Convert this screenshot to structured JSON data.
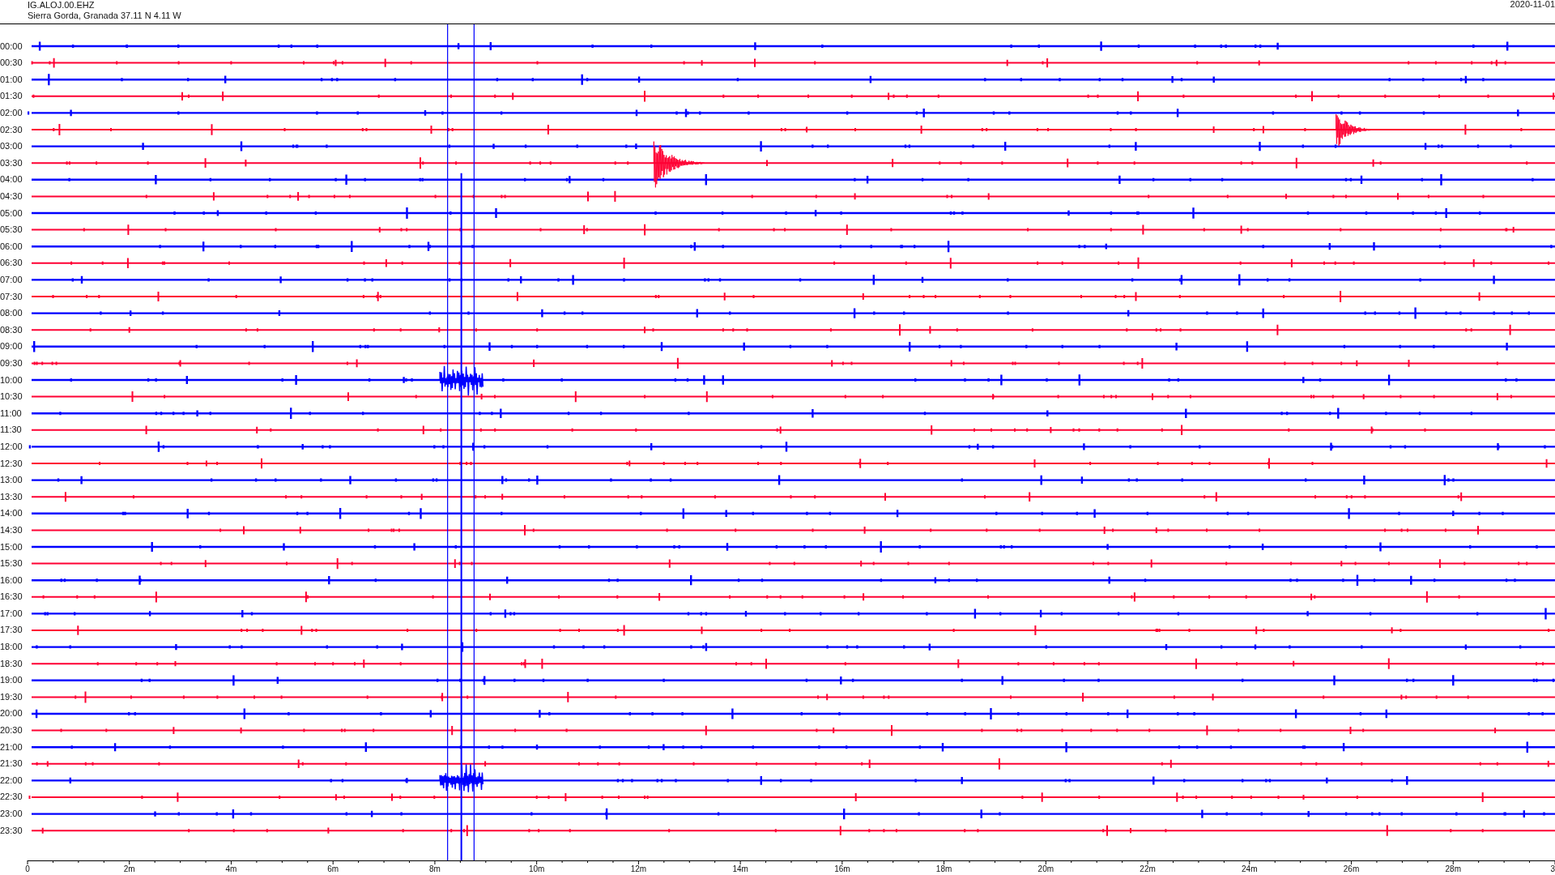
{
  "header": {
    "station": "IG.ALOJ.00.EHZ",
    "location": "Sierra Gorda, Granada  37.11 N 4.11 W",
    "date": "2020-11-01"
  },
  "rows": [
    {
      "time": "00:00",
      "color": "#0000ff"
    },
    {
      "time": "00:30",
      "color": "#ff0033"
    },
    {
      "time": "01:00",
      "color": "#0000ff"
    },
    {
      "time": "01:30",
      "color": "#ff0033"
    },
    {
      "time": "02:00",
      "color": "#0000ff"
    },
    {
      "time": "02:30",
      "color": "#ff0033"
    },
    {
      "time": "03:00",
      "color": "#0000ff"
    },
    {
      "time": "03:30",
      "color": "#ff0033"
    },
    {
      "time": "04:00",
      "color": "#0000ff"
    },
    {
      "time": "04:30",
      "color": "#ff0033"
    },
    {
      "time": "05:00",
      "color": "#0000ff"
    },
    {
      "time": "05:30",
      "color": "#ff0033"
    },
    {
      "time": "06:00",
      "color": "#0000ff"
    },
    {
      "time": "06:30",
      "color": "#ff0033"
    },
    {
      "time": "07:00",
      "color": "#0000ff"
    },
    {
      "time": "07:30",
      "color": "#ff0033"
    },
    {
      "time": "08:00",
      "color": "#0000ff"
    },
    {
      "time": "08:30",
      "color": "#ff0033"
    },
    {
      "time": "09:00",
      "color": "#0000ff"
    },
    {
      "time": "09:30",
      "color": "#ff0033"
    },
    {
      "time": "10:00",
      "color": "#0000ff"
    },
    {
      "time": "10:30",
      "color": "#ff0033"
    },
    {
      "time": "11:00",
      "color": "#0000ff"
    },
    {
      "time": "11:30",
      "color": "#ff0033"
    },
    {
      "time": "12:00",
      "color": "#0000ff"
    },
    {
      "time": "12:30",
      "color": "#ff0033"
    },
    {
      "time": "13:00",
      "color": "#0000ff"
    },
    {
      "time": "13:30",
      "color": "#ff0033"
    },
    {
      "time": "14:00",
      "color": "#0000ff"
    },
    {
      "time": "14:30",
      "color": "#ff0033"
    },
    {
      "time": "15:00",
      "color": "#0000ff"
    },
    {
      "time": "15:30",
      "color": "#ff0033"
    },
    {
      "time": "16:00",
      "color": "#0000ff"
    },
    {
      "time": "16:30",
      "color": "#ff0033"
    },
    {
      "time": "17:00",
      "color": "#0000ff"
    },
    {
      "time": "17:30",
      "color": "#ff0033"
    },
    {
      "time": "18:00",
      "color": "#0000ff"
    },
    {
      "time": "18:30",
      "color": "#ff0033"
    },
    {
      "time": "19:00",
      "color": "#0000ff"
    },
    {
      "time": "19:30",
      "color": "#ff0033"
    },
    {
      "time": "20:00",
      "color": "#0000ff"
    },
    {
      "time": "20:30",
      "color": "#ff0033"
    },
    {
      "time": "21:00",
      "color": "#0000ff"
    },
    {
      "time": "21:30",
      "color": "#ff0033"
    },
    {
      "time": "22:00",
      "color": "#0000ff"
    },
    {
      "time": "22:30",
      "color": "#ff0033"
    },
    {
      "time": "23:00",
      "color": "#0000ff"
    },
    {
      "time": "23:30",
      "color": "#ff0033"
    }
  ],
  "x_axis": {
    "tick_labels": [
      "0",
      "2m",
      "4m",
      "6m",
      "8m",
      "10m",
      "12m",
      "14m",
      "16m",
      "18m",
      "20m",
      "22m",
      "24m",
      "26m",
      "28m",
      "3"
    ]
  }
}
